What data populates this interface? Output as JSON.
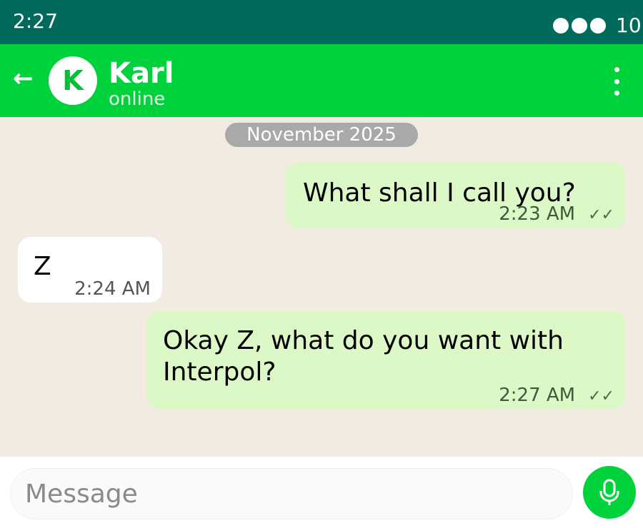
{
  "status_bar": {
    "time": "2:27",
    "battery_text": "10",
    "signal_icon": "signal-dots-icon"
  },
  "header": {
    "back_icon": "←",
    "avatar_letter": "K",
    "contact_name": "Karl",
    "contact_status": "online",
    "menu_icon": "more-vertical-icon"
  },
  "chat": {
    "date_label": "November 2025",
    "messages": [
      {
        "direction": "outgoing",
        "text": "What shall I call you?",
        "time": "2:23 AM",
        "ticks": "✓✓"
      },
      {
        "direction": "incoming",
        "text": "Z",
        "time": "2:24 AM"
      },
      {
        "direction": "outgoing",
        "text": "Okay Z, what do you want with Interpol?",
        "time": "2:27 AM",
        "ticks": "✓✓"
      }
    ]
  },
  "composer": {
    "placeholder": "Message",
    "value": "",
    "send_icon": "microphone-icon"
  },
  "colors": {
    "status_bar": "#006b5c",
    "header": "#00d23c",
    "chat_background": "#f2ebe1",
    "outgoing_bubble": "#dcf8c6",
    "incoming_bubble": "#ffffff",
    "date_chip": "#a9a9a9"
  }
}
